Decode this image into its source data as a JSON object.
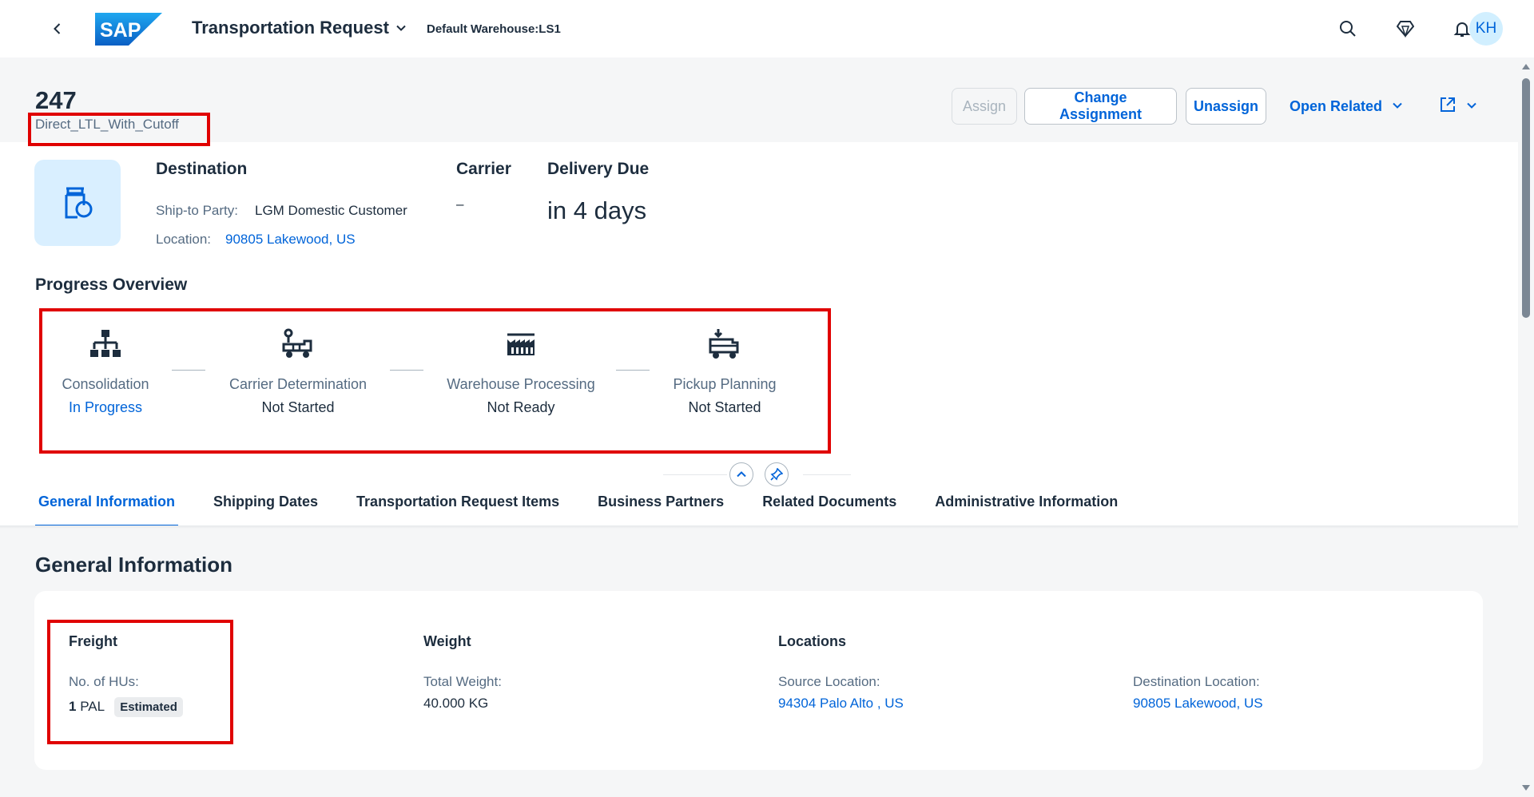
{
  "shell": {
    "app_title": "Transportation Request",
    "warehouse": "Default Warehouse:LS1",
    "avatar_initials": "KH",
    "logo_text": "SAP"
  },
  "header": {
    "title": "247",
    "subtitle": "Direct_LTL_With_Cutoff",
    "actions": {
      "assign": "Assign",
      "change_assignment": "Change Assignment",
      "unassign": "Unassign",
      "open_related": "Open Related"
    }
  },
  "destination": {
    "title": "Destination",
    "ship_to_label": "Ship-to Party:",
    "ship_to_value": "LGM Domestic Customer",
    "location_label": "Location:",
    "location_value": "90805 Lakewood, US"
  },
  "carrier": {
    "title": "Carrier",
    "value": "–"
  },
  "delivery": {
    "title": "Delivery Due",
    "value": "in 4 days"
  },
  "progress": {
    "title": "Progress Overview",
    "steps": [
      {
        "name": "Consolidation",
        "status": "In Progress"
      },
      {
        "name": "Carrier Determination",
        "status": "Not Started"
      },
      {
        "name": "Warehouse Processing",
        "status": "Not Ready"
      },
      {
        "name": "Pickup Planning",
        "status": "Not Started"
      }
    ]
  },
  "tabs": [
    "General Information",
    "Shipping Dates",
    "Transportation Request Items",
    "Business Partners",
    "Related Documents",
    "Administrative Information"
  ],
  "general": {
    "title": "General Information",
    "freight": {
      "title": "Freight",
      "hus_label": "No. of HUs:",
      "hus_count": "1",
      "hus_unit": "PAL",
      "badge": "Estimated"
    },
    "weight": {
      "title": "Weight",
      "label": "Total Weight:",
      "value": "40.000 KG"
    },
    "locations": {
      "title": "Locations",
      "source_label": "Source Location:",
      "source_value": "94304 Palo Alto , US",
      "dest_label": "Destination Location:",
      "dest_value": "90805 Lakewood, US"
    }
  },
  "colors": {
    "accent": "#0064d9",
    "highlight": "#e00000",
    "text": "#1d2d3e",
    "muted": "#556b82",
    "background": "#f5f6f7"
  },
  "icons": [
    "back-icon",
    "sap-logo",
    "chevron-down-icon",
    "search-icon",
    "diamond-icon",
    "bell-icon",
    "collapse-icon",
    "pin-icon",
    "share-icon",
    "hierarchy-icon",
    "truck-icon",
    "factory-icon",
    "pickup-icon",
    "box-icon"
  ]
}
